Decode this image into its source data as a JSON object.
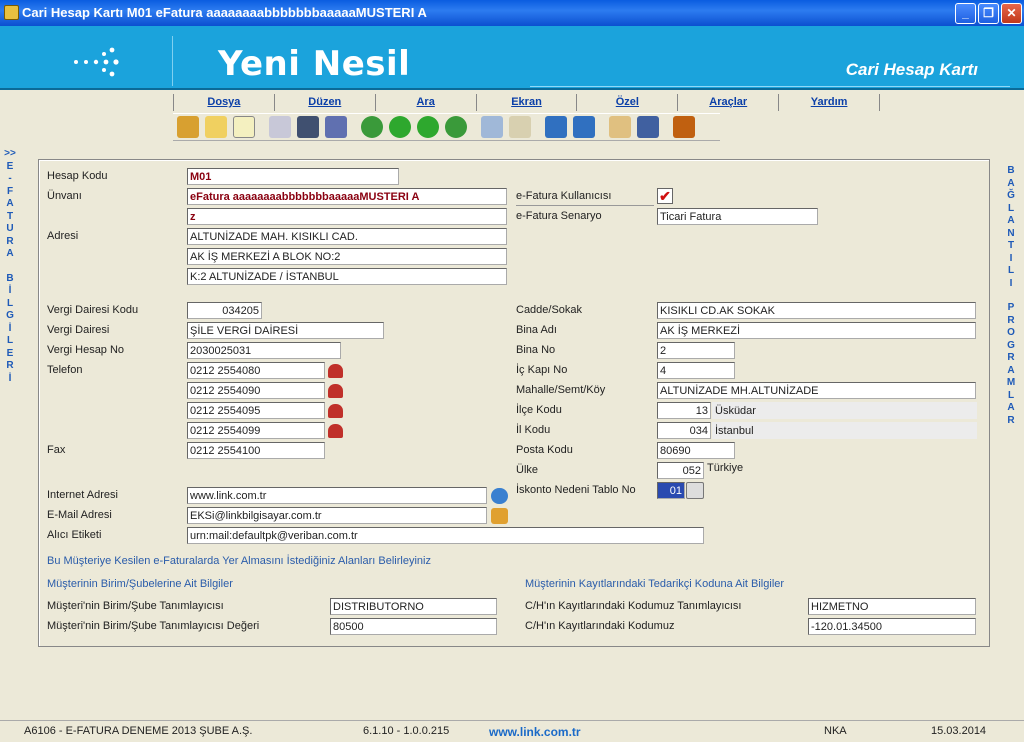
{
  "window": {
    "title": "Cari Hesap Kartı   M01 eFatura aaaaaaaabbbbbbbaaaaaMUSTERI A",
    "min": "_",
    "max": "❐",
    "close": "✕"
  },
  "banner": {
    "brand": "Yeni Nesil",
    "subtitle": "Cari Hesap Kartı"
  },
  "menu": [
    "Dosya",
    "Düzen",
    "Ara",
    "Ekran",
    "Özel",
    "Araçlar",
    "Yardım"
  ],
  "toolbar_icons": [
    "edit-icon",
    "note-icon",
    "document-icon",
    "preview-icon",
    "save-icon",
    "users-icon",
    "first-record-icon",
    "previous-record-icon",
    "next-record-icon",
    "last-record-icon",
    "search-icon",
    "clear-icon",
    "undo-icon",
    "redo-icon",
    "notepad-icon",
    "calendar-icon",
    "exit-icon"
  ],
  "left_side": {
    "arrow": ">>",
    "letters": [
      "E",
      "-",
      "F",
      "A",
      "T",
      "U",
      "R",
      "A",
      " ",
      "B",
      "İ",
      "L",
      "G",
      "İ",
      "L",
      "E",
      "R",
      "İ"
    ]
  },
  "right_side": {
    "letters": [
      "B",
      "A",
      "Ğ",
      "L",
      "A",
      "N",
      "T",
      "I",
      "L",
      "I",
      " ",
      "P",
      "R",
      "O",
      "G",
      "R",
      "A",
      "M",
      "L",
      "A",
      "R"
    ]
  },
  "labels": {
    "hesap_kodu": "Hesap Kodu",
    "unvani": "Ünvanı",
    "adresi": "Adresi",
    "vd_kodu": "Vergi Dairesi Kodu",
    "vd": "Vergi Dairesi",
    "vhn": "Vergi Hesap No",
    "telefon": "Telefon",
    "fax": "Fax",
    "internet": "Internet Adresi",
    "email": "E-Mail Adresi",
    "alici": "Alıcı Etiketi",
    "efk": "e-Fatura Kullanıcısı",
    "efs": "e-Fatura Senaryo",
    "cadde": "Cadde/Sokak",
    "bina_adi": "Bina Adı",
    "bina_no": "Bina No",
    "ic_kapi": "İç Kapı No",
    "mahalle": "Mahalle/Semt/Köy",
    "ilce": "İlçe Kodu",
    "il": "İl Kodu",
    "posta": "Posta Kodu",
    "ulke": "Ülke",
    "iskonto": "İskonto Nedeni Tablo No",
    "birim1": "Müşteri'nin Birim/Şube Tanımlayıcısı",
    "birim2": "Müşteri'nin Birim/Şube Tanımlayıcısı Değeri",
    "kayit1": "C/H'ın Kayıtlarındaki Kodumuz Tanımlayıcısı",
    "kayit2": "C/H'ın Kayıtlarındaki Kodumuz"
  },
  "sections": {
    "main": "Bu Müşteriye Kesilen e-Faturalarda Yer Almasını İstediğiniz Alanları Belirleyiniz",
    "left": "Müşterinin Birim/Şubelerine Ait Bilgiler",
    "right": "Müşterinin Kayıtlarındaki Tedarikçi Koduna Ait Bilgiler"
  },
  "values": {
    "hesap_kodu": "M01",
    "unvan1": "eFatura aaaaaaaabbbbbbbaaaaaMUSTERI A",
    "unvan2": "z",
    "adres1": "ALTUNİZADE MAH. KISIKLI CAD.",
    "adres2": "AK İŞ MERKEZİ A BLOK NO:2",
    "adres3": "K:2  ALTUNİZADE / İSTANBUL",
    "vd_kodu": "034205",
    "vd": "ŞİLE VERGİ DAİRESİ",
    "vhn": "2030025031",
    "tel1": "0212 2554080",
    "tel2": "0212 2554090",
    "tel3": "0212 2554095",
    "tel4": "0212 2554099",
    "fax": "0212 2554100",
    "internet": "www.link.com.tr",
    "email": "EKSi@linkbilgisayar.com.tr",
    "alici": "urn:mail:defaultpk@veriban.com.tr",
    "efk_check": "✔",
    "efs": "Ticari Fatura",
    "cadde": "KISIKLI CD.AK SOKAK",
    "bina_adi": "AK İŞ MERKEZİ",
    "bina_no": "2",
    "ic_kapi": "4",
    "mahalle": "ALTUNİZADE MH.ALTUNİZADE",
    "ilce_kod": "13",
    "ilce_ad": "Üsküdar",
    "il_kod": "034",
    "il_ad": "İstanbul",
    "posta": "80690",
    "ulke_kod": "052",
    "ulke_ad": "Türkiye",
    "iskonto": "01",
    "birim1": "DISTRIBUTORNO",
    "birim2": "80500",
    "kayit1": "HIZMETNO",
    "kayit2": "-120.01.34500"
  },
  "status": {
    "company": "A6106 - E-FATURA DENEME 2013 ŞUBE A.Ş.",
    "version": "6.1.10 - 1.0.0.215",
    "web": "www.link.com.tr",
    "user": "NKA",
    "date": "15.03.2014"
  }
}
